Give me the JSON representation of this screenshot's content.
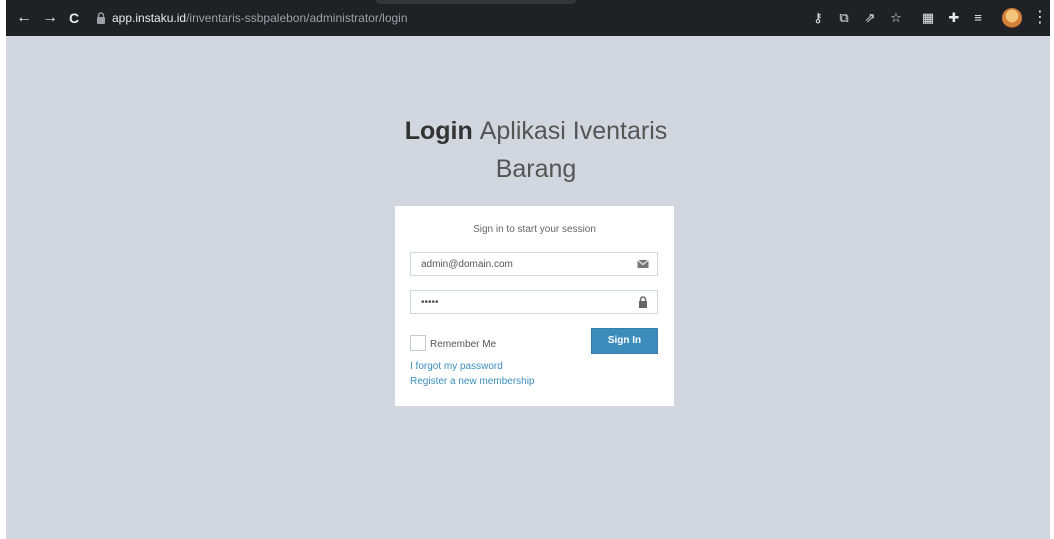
{
  "browser": {
    "url_host": "app.instaku.id",
    "url_path": "/inventaris-ssbpalebon/administrator/login",
    "back_icon": "arrow-left-icon",
    "forward_icon": "arrow-right-icon",
    "reload_icon": "reload-icon",
    "glyphs": {
      "back": "←",
      "forward": "→",
      "reload": "C",
      "key": "⚷",
      "translate": "⧉",
      "share": "⇗",
      "star": "☆",
      "grid": "▦",
      "puzzle": "✚",
      "media": "≡",
      "sidepanel": "◧",
      "more": "⋮"
    }
  },
  "page": {
    "title_bold": "Login",
    "title_rest": "Aplikasi Iventaris",
    "title_line2": "Barang"
  },
  "login_box": {
    "message": "Sign in to start your session",
    "email_value": "admin@domain.com",
    "password_value": "•••••",
    "remember_label": "Remember Me",
    "remember_checked": false,
    "signin_label": "Sign In",
    "forgot_link": "I forgot my password",
    "register_link": "Register a new membership"
  },
  "colors": {
    "background": "#d2d6de",
    "primary": "#3c8dbc",
    "chrome": "#202124"
  }
}
